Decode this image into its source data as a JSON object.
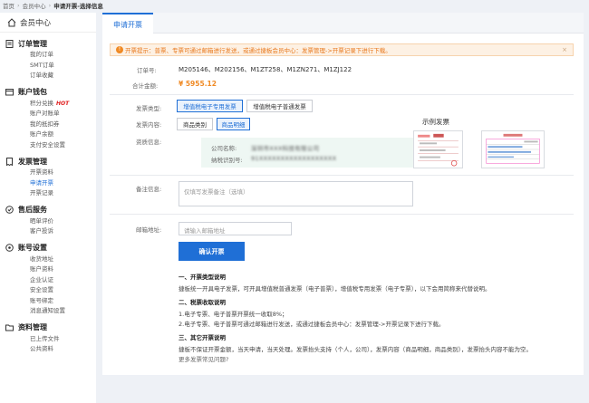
{
  "breadcrumb": {
    "items": [
      "首页",
      "会员中心",
      "申请开票-选择信息"
    ]
  },
  "sidebar": {
    "title": "会员中心",
    "groups": [
      {
        "title": "订单管理",
        "items": [
          {
            "label": "我的订单"
          },
          {
            "label": "SMT订单"
          },
          {
            "label": "订单收藏"
          }
        ]
      },
      {
        "title": "账户钱包",
        "items": [
          {
            "label": "积分兑换",
            "badge": "HOT"
          },
          {
            "label": "账户对账单"
          },
          {
            "label": "我的抵扣券"
          },
          {
            "label": "账户余额"
          },
          {
            "label": "支付安全设置"
          }
        ]
      },
      {
        "title": "发票管理",
        "items": [
          {
            "label": "开票资料"
          },
          {
            "label": "申请开票",
            "active": true
          },
          {
            "label": "开票记录"
          }
        ]
      },
      {
        "title": "售后服务",
        "items": [
          {
            "label": "晒单评价"
          },
          {
            "label": "客户投诉"
          }
        ]
      },
      {
        "title": "账号设置",
        "items": [
          {
            "label": "收货地址"
          },
          {
            "label": "账户资料"
          },
          {
            "label": "企业认证"
          },
          {
            "label": "安全设置"
          },
          {
            "label": "账号绑定"
          },
          {
            "label": "消息通知设置"
          }
        ]
      },
      {
        "title": "资料管理",
        "items": [
          {
            "label": "已上传文件"
          },
          {
            "label": "公共资料"
          }
        ]
      }
    ]
  },
  "tab": {
    "label": "申请开票"
  },
  "notice": {
    "text": "开票提示：普票、专票可通过邮箱进行发送，或通过捷板会员中心：发票管理->开票记录下进行下载。"
  },
  "order": {
    "order_label": "订单号:",
    "order_value": "M205146、M202156、M1ZT258、M1ZN271、M1ZJ122",
    "amount_label": "合计金额:",
    "amount_value": "¥ 5955.12"
  },
  "invoice": {
    "type_label": "发票类型:",
    "types": [
      "增值税电子专用发票",
      "增值税电子普通发票"
    ],
    "content_label": "发票内容:",
    "contents": [
      "商品类别",
      "商品明细"
    ],
    "qual_label": "资质信息:",
    "company_key": "公司名称:",
    "company_value": "深圳市XXX科技有限公司",
    "tax_key": "纳税识别号:",
    "tax_value": "91XXXXXXXXXXXXXXXXXX",
    "sample_label": "示例发票",
    "remark_label": "备注信息:",
    "remark_placeholder": "仅填写发票备注（选填）",
    "email_label": "邮箱地址:",
    "email_placeholder": "请输入邮箱地址",
    "submit_label": "确认开票"
  },
  "help": {
    "h1": "一、开票类型说明",
    "p1": "捷板统一开具电子发票，可开具增值税普通发票（电子普票），增值税专用发票（电子专票），以下会用简称来代替说明。",
    "h2": "二、税票收取说明",
    "p2a": "1.电子专票、电子普票开票统一收取8%；",
    "p2b": "2.电子专票、电子普票可通过邮箱进行发送，或通过捷板会员中心：发票管理->开票记录下进行下载。",
    "h3": "三、其它开票说明",
    "p3": "捷板不保证开票金额，当天申请，当天处理。发票抬头支持（个人，公司），发票内容（商品明细，商品类别），发票抬头内容不能为空。",
    "more": "更多发票常见问题?"
  },
  "colors": {
    "accent": "#1f6fd6",
    "warning": "#f08a24",
    "notice_bg": "#fdf1e4",
    "hot": "#e02020"
  }
}
